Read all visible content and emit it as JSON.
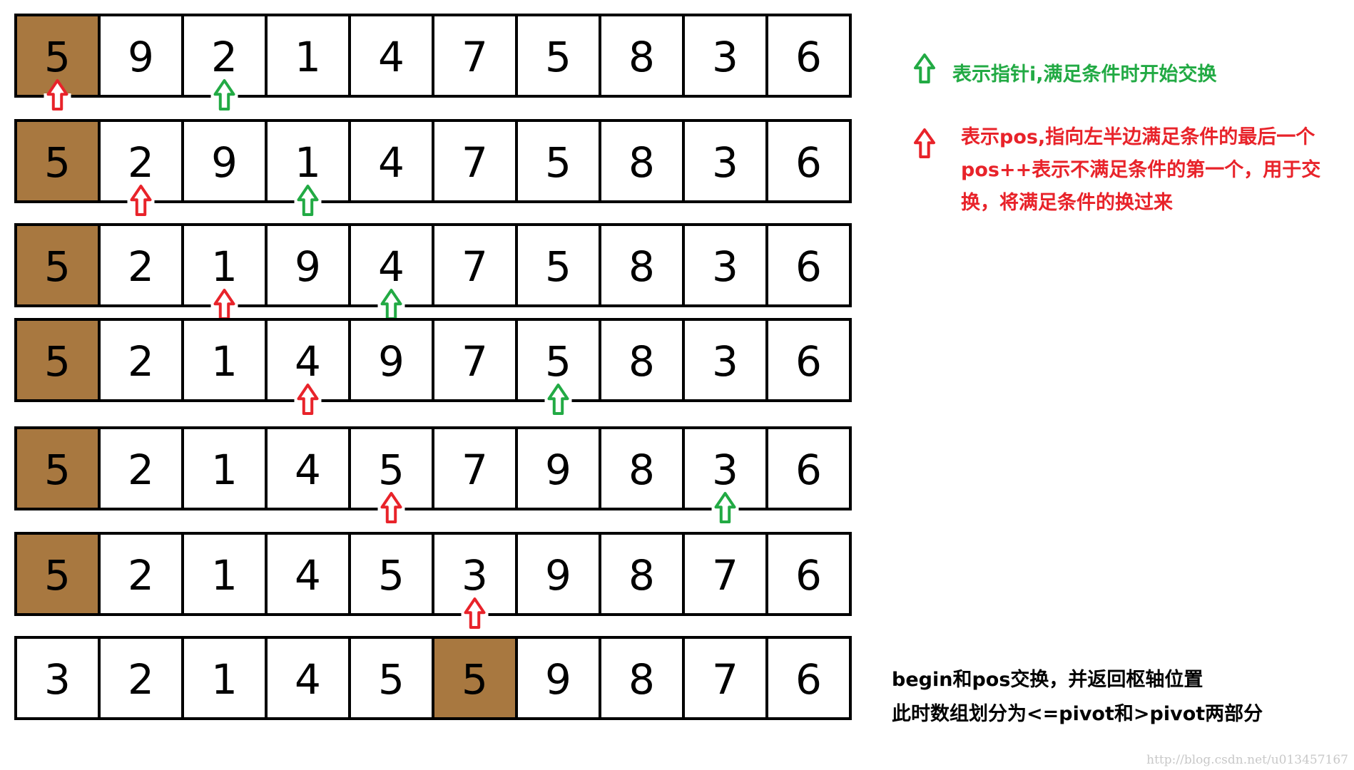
{
  "rows": [
    {
      "values": [
        "5",
        "9",
        "2",
        "1",
        "4",
        "7",
        "5",
        "8",
        "3",
        "6"
      ],
      "pivot_index": 0,
      "pos_index": 0,
      "i_index": 2
    },
    {
      "values": [
        "5",
        "2",
        "9",
        "1",
        "4",
        "7",
        "5",
        "8",
        "3",
        "6"
      ],
      "pivot_index": 0,
      "pos_index": 1,
      "i_index": 3
    },
    {
      "values": [
        "5",
        "2",
        "1",
        "9",
        "4",
        "7",
        "5",
        "8",
        "3",
        "6"
      ],
      "pivot_index": 0,
      "pos_index": 2,
      "i_index": 4
    },
    {
      "values": [
        "5",
        "2",
        "1",
        "4",
        "9",
        "7",
        "5",
        "8",
        "3",
        "6"
      ],
      "pivot_index": 0,
      "pos_index": 3,
      "i_index": 6
    },
    {
      "values": [
        "5",
        "2",
        "1",
        "4",
        "5",
        "7",
        "9",
        "8",
        "3",
        "6"
      ],
      "pivot_index": 0,
      "pos_index": 4,
      "i_index": 8
    },
    {
      "values": [
        "5",
        "2",
        "1",
        "4",
        "5",
        "3",
        "9",
        "8",
        "7",
        "6"
      ],
      "pivot_index": 0,
      "pos_index": 5,
      "i_index": null
    },
    {
      "values": [
        "3",
        "2",
        "1",
        "4",
        "5",
        "5",
        "9",
        "8",
        "7",
        "6"
      ],
      "pivot_index": 5,
      "pos_index": null,
      "i_index": null
    }
  ],
  "legend": {
    "green_text": "表示指针i,满足条件时开始交换",
    "red_lines": [
      "表示pos,指向左半边满足条件的最后一个",
      "pos++表示不满足条件的第一个，用于交",
      "换，将满足条件的换过来"
    ]
  },
  "note": {
    "lines": [
      "begin和pos交换，并返回枢轴位置",
      "此时数组划分为<=pivot和>pivot两部分"
    ]
  },
  "watermark": "http://blog.csdn.net/u013457167",
  "colors": {
    "pivot": "#a87840",
    "i_arrow": "#22aa44",
    "pos_arrow": "#e8232a"
  },
  "icons": {
    "i_arrow": "green-up-arrow-icon",
    "pos_arrow": "red-up-arrow-icon"
  }
}
